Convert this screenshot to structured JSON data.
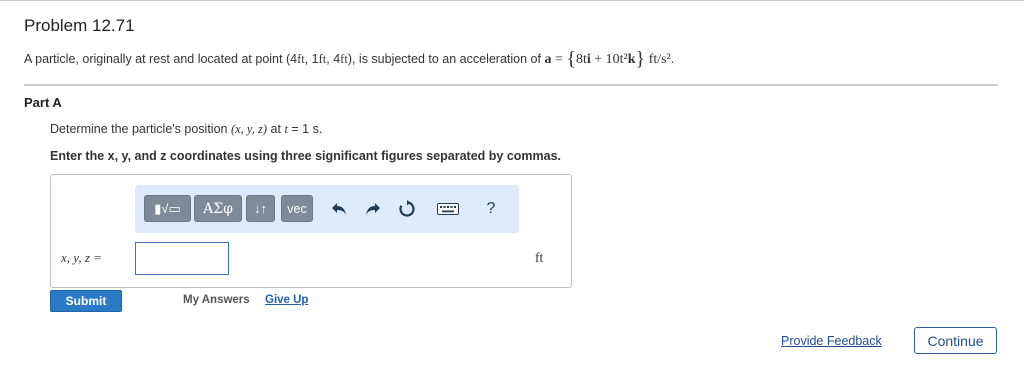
{
  "problem": {
    "title": "Problem 12.71",
    "statement_prefix": "A particle, originally at rest and located at point (4",
    "unit_ft": "ft",
    "comma1": ", 1",
    "comma2": ", 4",
    "statement_mid": "), is subjected to an acceleration of",
    "accel_symbol": "a",
    "equals": " = ",
    "open_brace": "{",
    "accel_part1": "8t",
    "unit_i": "i",
    "plus": " + 10t²",
    "unit_k": "k",
    "close_brace": "}",
    "accel_unit": " ft/s²",
    "period": "."
  },
  "part": {
    "label": "Part A",
    "question_prefix": "Determine the particle's position ",
    "question_vars": "(x, y, z)",
    "question_at": " at ",
    "question_t": "t",
    "question_suffix": " = 1 s.",
    "instruction": "Enter the x, y, and z coordinates using three significant figures separated by commas."
  },
  "toolbar": {
    "templates_label": "▮√▭",
    "greek_label": "ΑΣφ",
    "arrows_label": "↓↑",
    "vec_label": "vec",
    "undo_icon": "undo-icon",
    "redo_icon": "redo-icon",
    "reset_icon": "reset-icon",
    "keyboard_icon": "keyboard-icon",
    "help_label": "?"
  },
  "answer": {
    "variable_label": "x, y, z =",
    "value": "",
    "unit": "ft"
  },
  "actions": {
    "submit_label": "Submit",
    "my_answers_label": "My Answers",
    "give_up_label": "Give Up",
    "feedback_label": "Provide Feedback",
    "continue_label": "Continue"
  },
  "colors": {
    "accent": "#2a7ac5",
    "toolbar_bg": "#dceafb",
    "toolbar_button": "#7d8a97",
    "link": "#1f4f8f"
  }
}
